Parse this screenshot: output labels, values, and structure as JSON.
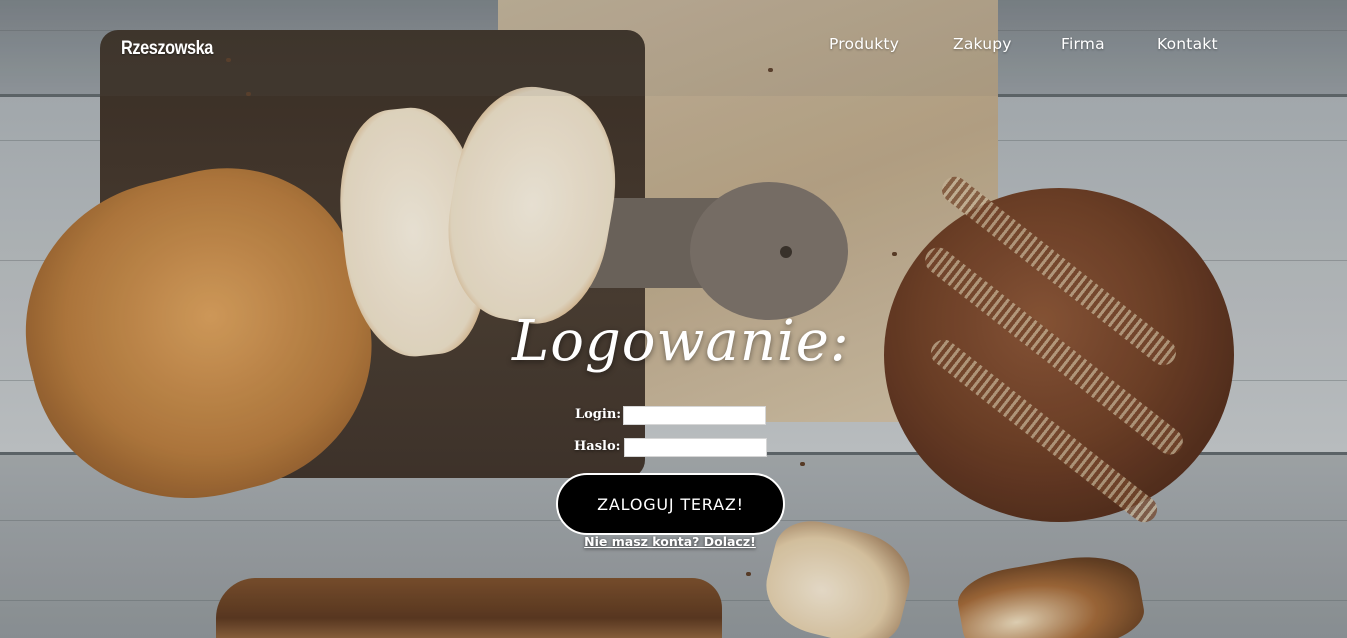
{
  "brand": {
    "name": "Rzeszowska"
  },
  "nav": {
    "items": [
      {
        "label": "Produkty"
      },
      {
        "label": "Zakupy"
      },
      {
        "label": "Firma"
      },
      {
        "label": "Kontakt"
      }
    ]
  },
  "login": {
    "title": "Logowanie:",
    "login_label": "Login:",
    "login_value": "",
    "password_label": "Haslo:",
    "password_value": "",
    "submit_label": "ZALOGUJ TERAZ!",
    "register_link": "Nie masz konta? Dolacz!"
  },
  "colors": {
    "button_bg": "#000000",
    "button_text": "#ffffff",
    "text": "#ffffff"
  }
}
